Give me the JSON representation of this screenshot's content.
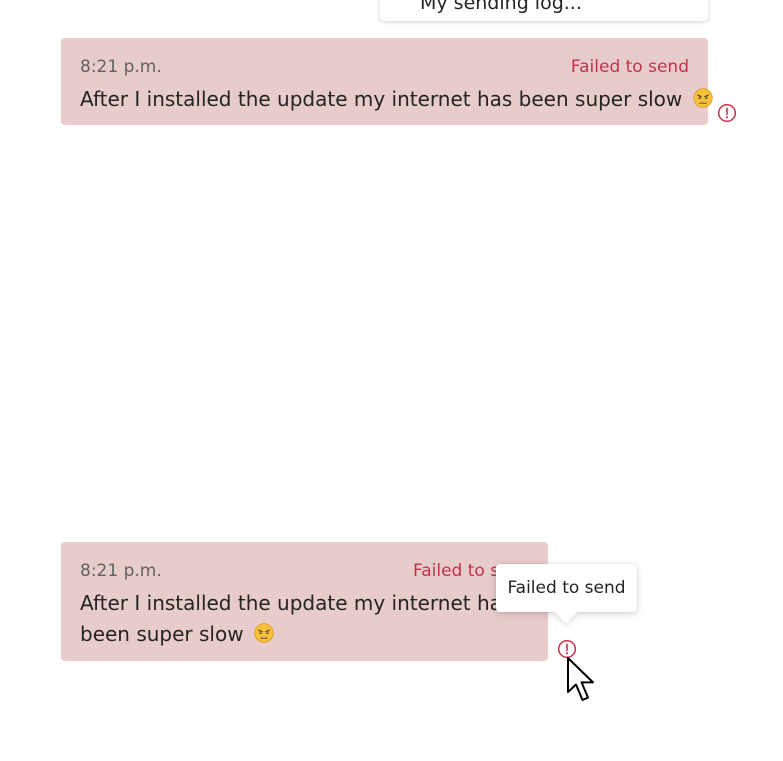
{
  "previous_card": {
    "partial_text": "My sending log..."
  },
  "messages": [
    {
      "time": "8:21 p.m.",
      "status": "Failed to send",
      "text": "After I installed the update my internet has been super slow",
      "emoji": "weary-face-emoji"
    },
    {
      "time": "8:21 p.m.",
      "status": "Failed to s",
      "text": "After I installed the update my internet has been super slow",
      "emoji": "weary-face-emoji"
    }
  ],
  "tooltip": {
    "text": "Failed to send"
  },
  "colors": {
    "bubble_error_bg": "#e8cbcb",
    "error_red": "#c4314b",
    "timestamp_gray": "#616161",
    "text_dark": "#242424"
  },
  "icons": [
    "error-circle-icon",
    "weary-face-emoji",
    "mouse-pointer-icon"
  ]
}
